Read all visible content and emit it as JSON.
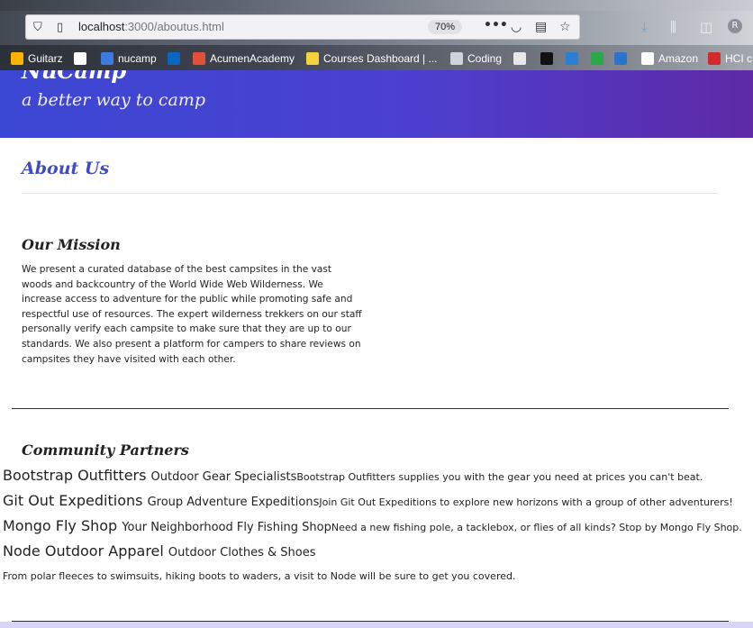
{
  "browser": {
    "url_host": "localhost",
    "url_path": ":3000/aboutus.html",
    "zoom": "70%",
    "bookmarks": [
      {
        "label": "Guitarz",
        "color": "#ffb000"
      },
      {
        "label": "",
        "color": "#ffffff"
      },
      {
        "label": "nucamp",
        "color": "#3d7be0"
      },
      {
        "label": "",
        "color": "#0a66c2"
      },
      {
        "label": "AcumenAcademy",
        "color": "#e0503a"
      },
      {
        "label": "Courses Dashboard | ...",
        "color": "#f3d23b"
      },
      {
        "label": "Coding",
        "color": "#cfd2d8"
      },
      {
        "label": "",
        "color": "#e8e8e8"
      },
      {
        "label": "",
        "color": "#111111"
      },
      {
        "label": "",
        "color": "#2a7fd4"
      },
      {
        "label": "",
        "color": "#2aa84a"
      },
      {
        "label": "",
        "color": "#2b74c9"
      },
      {
        "label": "Amazon",
        "color": "#ffffff"
      },
      {
        "label": "HCI c",
        "color": "#d12b2b"
      }
    ]
  },
  "page": {
    "brand": "NuCamp",
    "tagline": "a better way to camp",
    "about_title": "About Us",
    "mission_title": "Our Mission",
    "mission_text": "We present a curated database of the best campsites in the vast woods and backcountry of the World Wide Web Wilderness. We increase access to adventure for the public while promoting safe and respectful use of resources. The expert wilderness trekkers on our staff personally verify each campsite to make sure that they are up to our standards. We also present a platform for campers to share reviews on campsites they have visited with each other.",
    "partners_title": "Community Partners",
    "partners": [
      {
        "name": "Bootstrap Outfitters",
        "specialty": "Outdoor Gear Specialists",
        "description": "Bootstrap Outfitters supplies you with the gear you need at prices you can't beat."
      },
      {
        "name": "Git Out Expeditions",
        "specialty": "Group Adventure Expeditions",
        "description": "Join Git Out Expeditions to explore new horizons with a group of other adventurers!"
      },
      {
        "name": "Mongo Fly Shop",
        "specialty": "Your Neighborhood Fly Fishing Shop",
        "description": "Need a new fishing pole, a tacklebox, or flies of all kinds? Stop by Mongo Fly Shop."
      },
      {
        "name": "Node Outdoor Apparel",
        "specialty": "Outdoor Clothes & Shoes",
        "description": "From polar fleeces to swimsuits, hiking boots to waders, a visit to Node will be sure to get you covered."
      }
    ]
  }
}
